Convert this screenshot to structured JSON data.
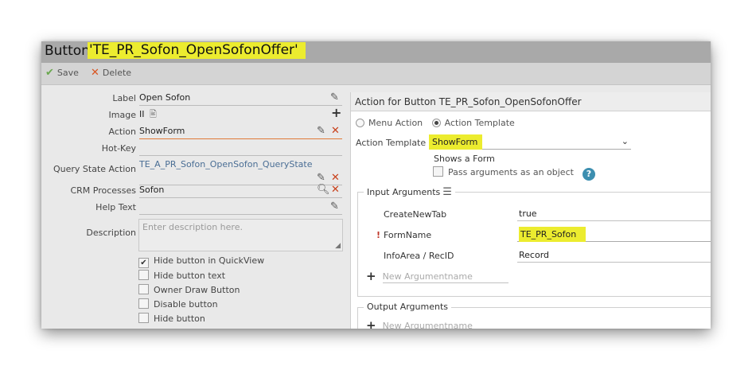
{
  "title": {
    "prefix": "Button",
    "name": "'TE_PR_Sofon_OpenSofonOffer'"
  },
  "toolbar": {
    "save_label": "Save",
    "delete_label": "Delete"
  },
  "form": {
    "label_label": "Label",
    "label_value": "Open Sofon",
    "image_label": "Image",
    "image_value": "II",
    "action_label": "Action",
    "action_value": "ShowForm",
    "hotkey_label": "Hot-Key",
    "hotkey_value": "",
    "query_label": "Query State Action",
    "query_value": "TE_A_PR_Sofon_OpenSofon_QueryState",
    "crm_label": "CRM Processes",
    "crm_value": "Sofon",
    "help_label": "Help Text",
    "help_value": "",
    "desc_label": "Description",
    "desc_placeholder": "Enter description here."
  },
  "checkboxes": [
    {
      "label": "Hide button in QuickView",
      "checked": true
    },
    {
      "label": "Hide button text",
      "checked": false
    },
    {
      "label": "Owner Draw Button",
      "checked": false
    },
    {
      "label": "Disable button",
      "checked": false
    },
    {
      "label": "Hide button",
      "checked": false
    }
  ],
  "action_panel": {
    "header": "Action for Button TE_PR_Sofon_OpenSofonOffer",
    "radio_menu_action": "Menu Action",
    "radio_action_template": "Action Template",
    "template_label": "Action Template",
    "template_value": "ShowForm",
    "shows": "Shows a Form",
    "pass_args": "Pass arguments as an object",
    "help_icon": "?"
  },
  "input_args": {
    "legend": "Input Arguments",
    "rows": [
      {
        "name": "CreateNewTab",
        "value": "true"
      },
      {
        "name": "FormName",
        "value": "TE_PR_Sofon",
        "required_mark": "!"
      },
      {
        "name": "InfoArea / RecID",
        "value": "Record"
      }
    ],
    "new_placeholder": "New Argumentname"
  },
  "output_args": {
    "legend": "Output Arguments",
    "new_placeholder": "New Argumentname"
  },
  "colors": {
    "highlight": "#ecec2f",
    "save_check": "#6aa84f",
    "delete_x": "#d9531e",
    "help_blue": "#3d8fb0"
  }
}
